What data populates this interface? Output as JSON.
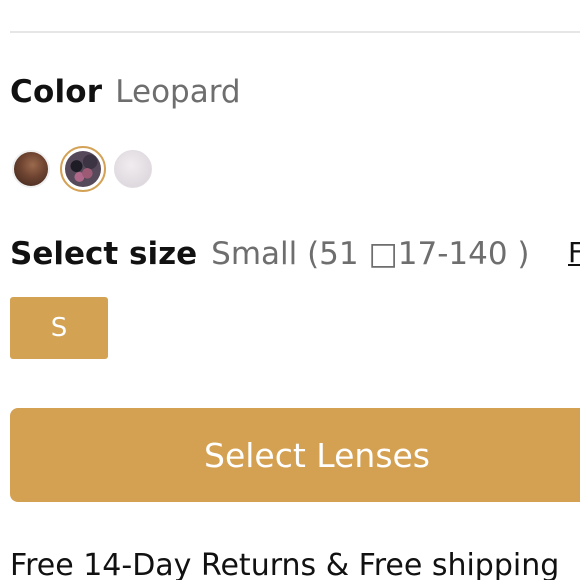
{
  "color": {
    "label": "Color",
    "selected": "Leopard",
    "swatches": [
      "brown-tortoise",
      "leopard",
      "clear-crystal"
    ]
  },
  "size": {
    "label": "Select size",
    "selected": "Small (51 □17-140 )",
    "guide_label": "F",
    "option_label": "S"
  },
  "cta": {
    "select_lenses": "Select Lenses"
  },
  "shipping_text": "Free 14-Day Returns & Free shipping",
  "colors": {
    "accent": "#d4a153",
    "selected_ring": "#d4a257",
    "muted_text": "#6e6e6e"
  }
}
